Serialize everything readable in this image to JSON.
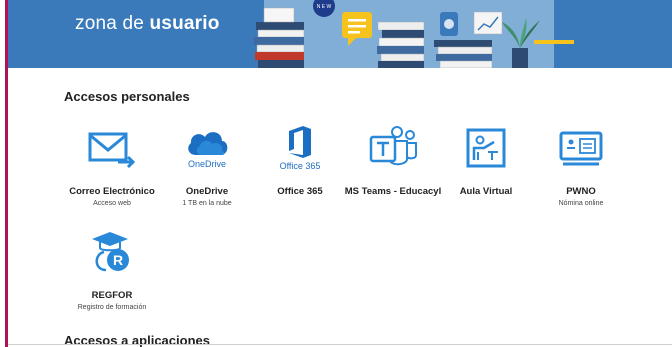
{
  "header": {
    "title_prefix": "zona de ",
    "title_bold": "usuario"
  },
  "sections": {
    "personal": "Accesos personales",
    "apps": "Accesos a aplicaciones"
  },
  "tiles": [
    {
      "name": "Correo Electrónico",
      "sub": "Acceso web",
      "icon": "mail-icon"
    },
    {
      "name": "OneDrive",
      "sub": "1 TB en la nube",
      "brand": "OneDrive",
      "icon": "onedrive-cloud-icon"
    },
    {
      "name": "Office 365",
      "sub": "",
      "brand": "Office 365",
      "icon": "office365-icon"
    },
    {
      "name": "MS Teams - Educacyl",
      "sub": "",
      "icon": "teams-icon"
    },
    {
      "name": "Aula Virtual",
      "sub": "",
      "icon": "classroom-board-icon"
    },
    {
      "name": "PWNO",
      "sub": "Nómina online",
      "icon": "payroll-card-icon"
    },
    {
      "name": "REGFOR",
      "sub": "Registro de formación",
      "icon": "graduation-r-icon"
    }
  ],
  "colors": {
    "banner": "#3a7abb",
    "accent_border": "#b0125a",
    "icon_blue": "#2a88d8"
  }
}
